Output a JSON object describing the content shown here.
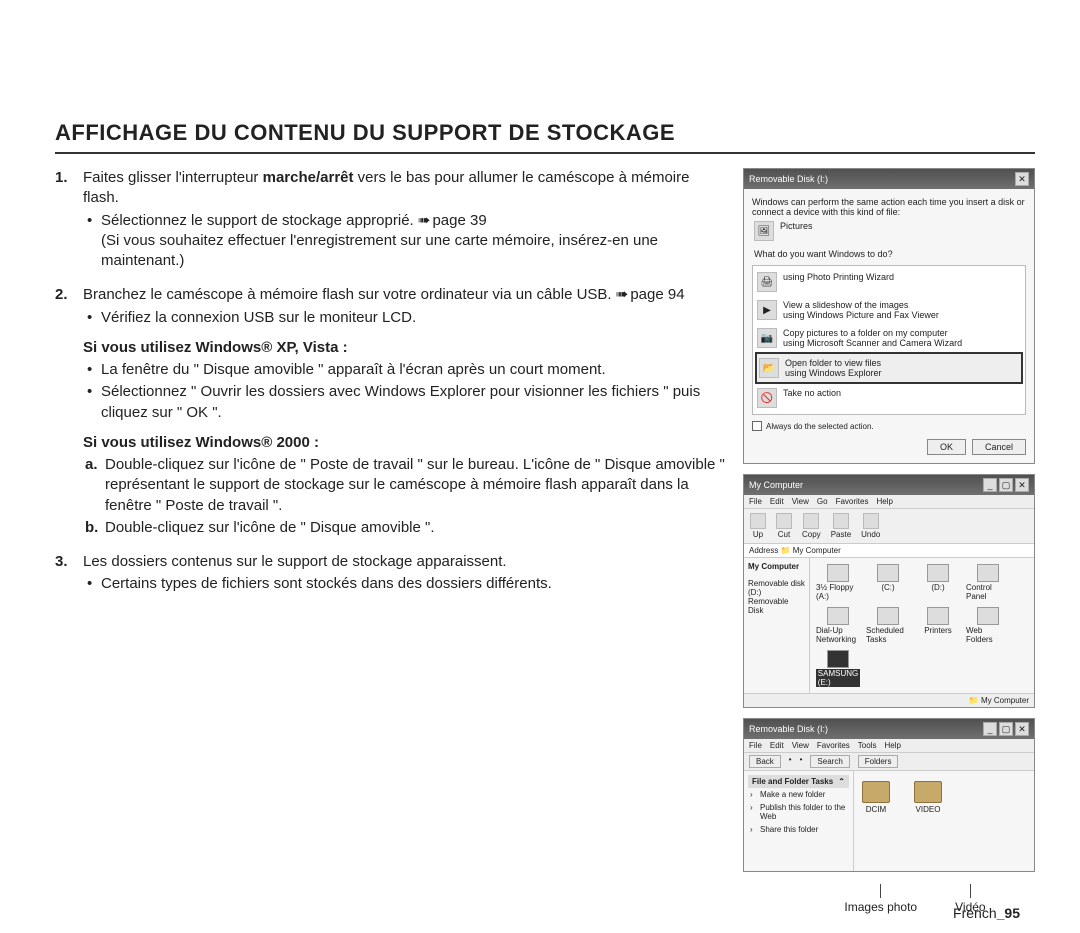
{
  "title": "AFFICHAGE DU CONTENU DU SUPPORT DE STOCKAGE",
  "step1": {
    "num": "1.",
    "text_a": "Faites glisser l'interrupteur ",
    "bold": "marche/arrêt",
    "text_b": " vers le bas pour allumer le caméscope à mémoire flash.",
    "b1_a": "Sélectionnez le support de stockage approprié. ",
    "b1_ref": "page 39",
    "b1_paren": "(Si vous souhaitez effectuer l'enregistrement sur une carte mémoire, insérez-en une maintenant.)"
  },
  "step2": {
    "num": "2.",
    "text_a": "Branchez le caméscope à mémoire flash sur votre ordinateur via un câble USB. ",
    "ref": "page 94",
    "b1": "Vérifiez la connexion USB sur le moniteur LCD."
  },
  "xp": {
    "heading": "Si vous utilisez Windows® XP, Vista :",
    "b1": "La fenêtre du \" Disque amovible \" apparaît à l'écran après un court moment.",
    "b2": "Sélectionnez \" Ouvrir les dossiers avec Windows Explorer pour visionner les fichiers \" puis cliquez sur \" OK \"."
  },
  "w2000": {
    "heading": "Si vous utilisez Windows® 2000 :",
    "a_lbl": "a.",
    "a_text": "Double-cliquez sur l'icône de \" Poste de travail \" sur le bureau. L'icône de \" Disque amovible \" représentant le support de stockage sur le caméscope à mémoire flash apparaît dans la fenêtre \" Poste de travail \".",
    "b_lbl": "b.",
    "b_text": "Double-cliquez sur l'icône de \" Disque amovible \"."
  },
  "step3": {
    "num": "3.",
    "text": "Les dossiers contenus sur le support de stockage apparaissent.",
    "b1": "Certains types de fichiers sont stockés dans des dossiers différents."
  },
  "dialog": {
    "title": "Removable Disk (I:)",
    "intro": "Windows can perform the same action each time you insert a disk or connect a device with this kind of file:",
    "pic_label": "Pictures",
    "question": "What do you want Windows to do?",
    "opt1": "using Photo Printing Wizard",
    "opt2a": "View a slideshow of the images",
    "opt2b": "using Windows Picture and Fax Viewer",
    "opt3a": "Copy pictures to a folder on my computer",
    "opt3b": "using Microsoft Scanner and Camera Wizard",
    "opt4a": "Open folder to view files",
    "opt4b": "using Windows Explorer",
    "opt5": "Take no action",
    "check": "Always do the selected action.",
    "ok": "OK",
    "cancel": "Cancel"
  },
  "mycomp": {
    "title": "My Computer",
    "menu": [
      "File",
      "Edit",
      "View",
      "Go",
      "Favorites",
      "Help"
    ],
    "tools": [
      "Up",
      "Cut",
      "Copy",
      "Paste",
      "Undo"
    ],
    "addr": "Address 📁 My Computer",
    "side_big": "My Computer",
    "side_items": [
      "Removable disk (D:)",
      "Removable Disk"
    ],
    "drives": [
      "3½ Floppy (A:)",
      "(C:)",
      "(D:)",
      "Control Panel",
      "Dial-Up Networking",
      "Scheduled Tasks",
      "Printers",
      "Web Folders",
      "SAMSUNG (E:)"
    ],
    "status": "📁 My Computer"
  },
  "remov": {
    "title": "Removable Disk (I:)",
    "menu": [
      "File",
      "Edit",
      "View",
      "Favorites",
      "Tools",
      "Help"
    ],
    "back": "Back",
    "search": "Search",
    "folders": "Folders",
    "tasks_head": "File and Folder Tasks",
    "tasks": [
      "Make a new folder",
      "Publish this folder to the Web",
      "Share this folder"
    ],
    "f1": "DCIM",
    "f2": "VIDEO"
  },
  "callouts": {
    "photo": "Images photo",
    "video": "Vidéo"
  },
  "footer": {
    "lang": "French",
    "sep": "_",
    "page": "95"
  }
}
